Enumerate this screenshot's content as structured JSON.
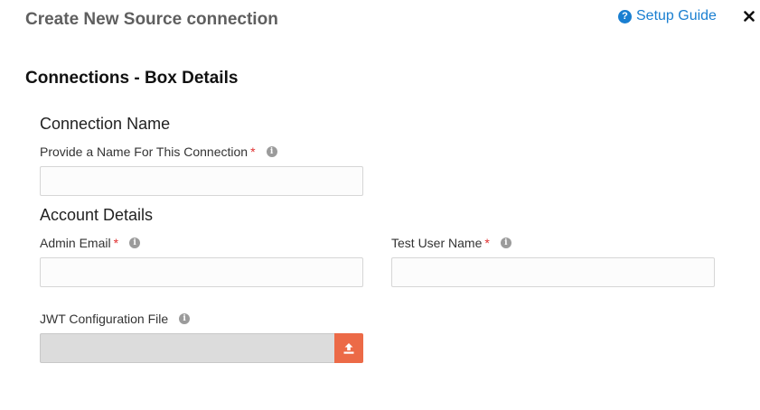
{
  "dialog": {
    "title": "Create New Source connection",
    "setup_guide_label": "Setup Guide",
    "close_symbol": "✕"
  },
  "section": {
    "heading": "Connections - Box Details"
  },
  "connection_name": {
    "heading": "Connection Name",
    "name_label": "Provide a Name For This Connection",
    "name_required": "*",
    "name_value": ""
  },
  "account_details": {
    "heading": "Account Details",
    "admin_email_label": "Admin Email",
    "admin_email_required": "*",
    "admin_email_value": "",
    "test_user_label": "Test User Name",
    "test_user_required": "*",
    "test_user_value": "",
    "jwt_label": "JWT Configuration File"
  },
  "icons": {
    "help": "question-circle-icon",
    "info": "info-icon",
    "close": "close-icon",
    "upload": "upload-icon"
  },
  "colors": {
    "link": "#1a7fd1",
    "required": "#e03030",
    "upload_button": "#ec6a47",
    "title": "#5f5f5f"
  }
}
